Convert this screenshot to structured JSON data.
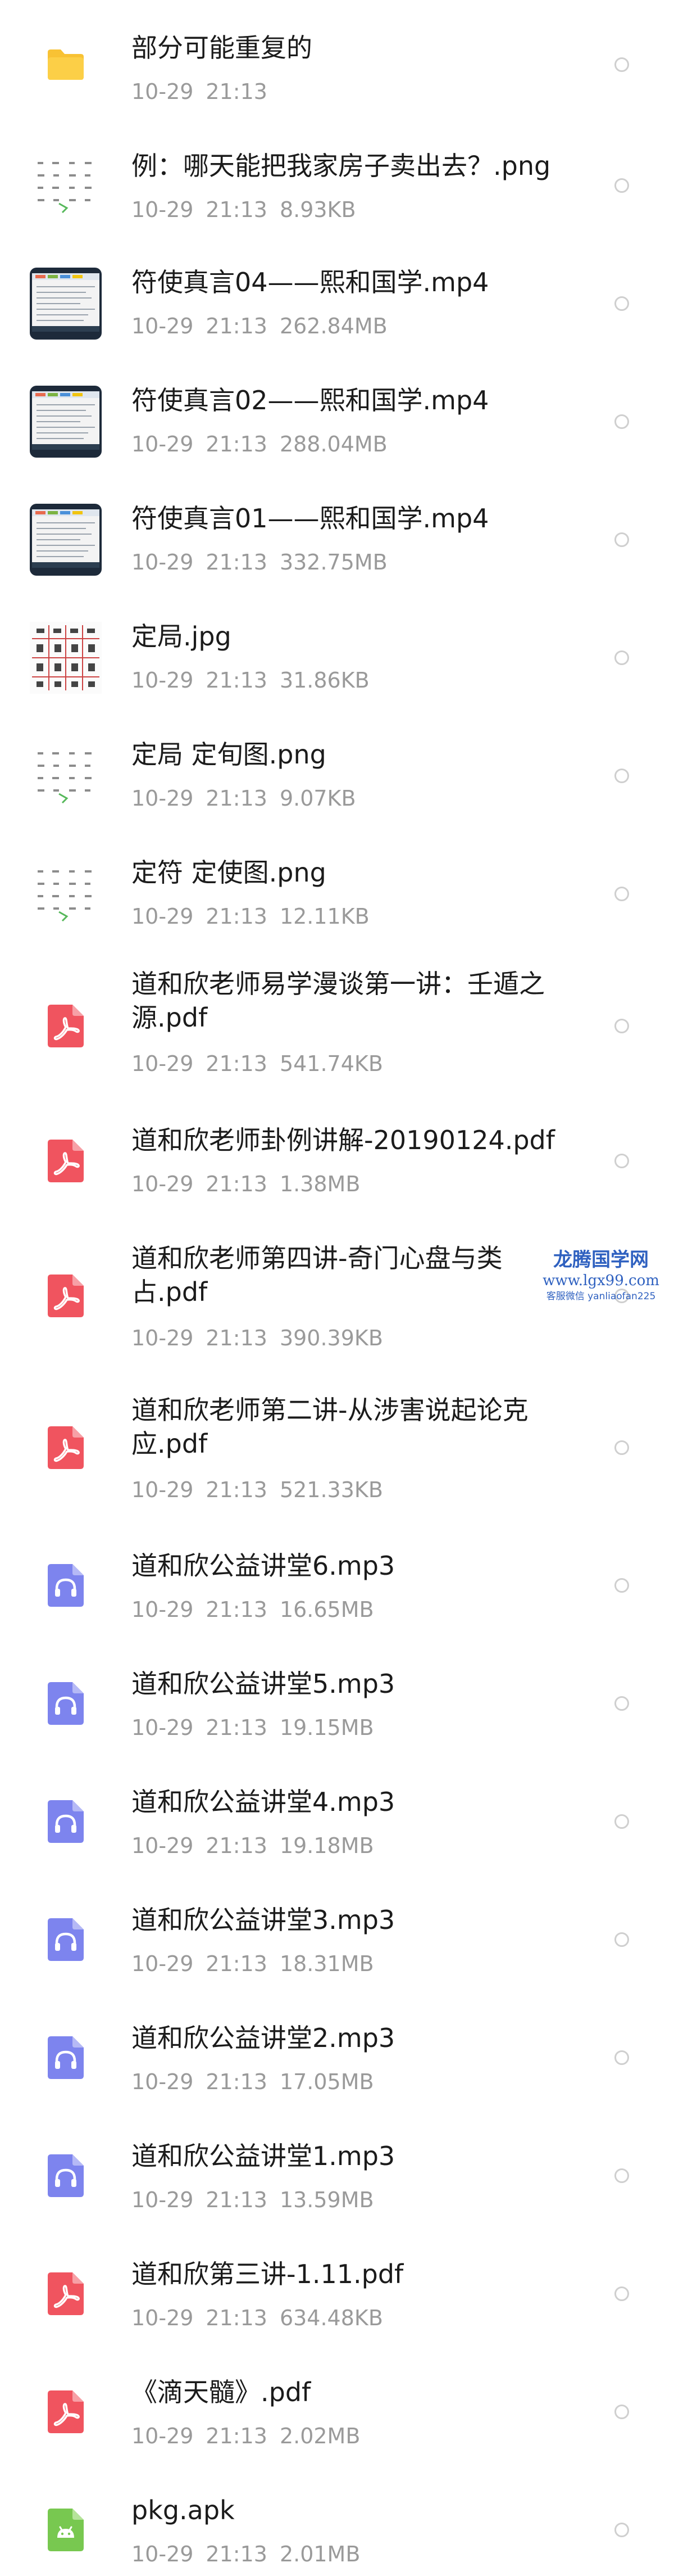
{
  "files": [
    {
      "name": "部分可能重复的",
      "date": "10-29",
      "time": "21:13",
      "size": "",
      "type": "folder"
    },
    {
      "name": "例：哪天能把我家房子卖出去？.png",
      "date": "10-29",
      "time": "21:13",
      "size": "8.93KB",
      "type": "image"
    },
    {
      "name": "符使真言04——熙和国学.mp4",
      "date": "10-29",
      "time": "21:13",
      "size": "262.84MB",
      "type": "video"
    },
    {
      "name": "符使真言02——熙和国学.mp4",
      "date": "10-29",
      "time": "21:13",
      "size": "288.04MB",
      "type": "video"
    },
    {
      "name": "符使真言01——熙和国学.mp4",
      "date": "10-29",
      "time": "21:13",
      "size": "332.75MB",
      "type": "video"
    },
    {
      "name": "定局.jpg",
      "date": "10-29",
      "time": "21:13",
      "size": "31.86KB",
      "type": "image-table"
    },
    {
      "name": "定局 定旬图.png",
      "date": "10-29",
      "time": "21:13",
      "size": "9.07KB",
      "type": "image"
    },
    {
      "name": "定符 定使图.png",
      "date": "10-29",
      "time": "21:13",
      "size": "12.11KB",
      "type": "image"
    },
    {
      "name": "道和欣老师易学漫谈第一讲：壬遁之\n源.pdf",
      "date": "10-29",
      "time": "21:13",
      "size": "541.74KB",
      "type": "pdf"
    },
    {
      "name": "道和欣老师卦例讲解-20190124.pdf",
      "date": "10-29",
      "time": "21:13",
      "size": "1.38MB",
      "type": "pdf"
    },
    {
      "name": "道和欣老师第四讲-奇门心盘与类\n占.pdf",
      "date": "10-29",
      "time": "21:13",
      "size": "390.39KB",
      "type": "pdf"
    },
    {
      "name": "道和欣老师第二讲-从涉害说起论克\n应.pdf",
      "date": "10-29",
      "time": "21:13",
      "size": "521.33KB",
      "type": "pdf"
    },
    {
      "name": "道和欣公益讲堂6.mp3",
      "date": "10-29",
      "time": "21:13",
      "size": "16.65MB",
      "type": "audio"
    },
    {
      "name": "道和欣公益讲堂5.mp3",
      "date": "10-29",
      "time": "21:13",
      "size": "19.15MB",
      "type": "audio"
    },
    {
      "name": "道和欣公益讲堂4.mp3",
      "date": "10-29",
      "time": "21:13",
      "size": "19.18MB",
      "type": "audio"
    },
    {
      "name": "道和欣公益讲堂3.mp3",
      "date": "10-29",
      "time": "21:13",
      "size": "18.31MB",
      "type": "audio"
    },
    {
      "name": "道和欣公益讲堂2.mp3",
      "date": "10-29",
      "time": "21:13",
      "size": "17.05MB",
      "type": "audio"
    },
    {
      "name": "道和欣公益讲堂1.mp3",
      "date": "10-29",
      "time": "21:13",
      "size": "13.59MB",
      "type": "audio"
    },
    {
      "name": "道和欣第三讲-1.11.pdf",
      "date": "10-29",
      "time": "21:13",
      "size": "634.48KB",
      "type": "pdf"
    },
    {
      "name": "《滴天髓》.pdf",
      "date": "10-29",
      "time": "21:13",
      "size": "2.02MB",
      "type": "pdf"
    },
    {
      "name": "pkg.apk",
      "date": "10-29",
      "time": "21:13",
      "size": "2.01MB",
      "type": "apk"
    }
  ],
  "watermark": {
    "title": "龙腾国学网",
    "url": "www.lgx99.com",
    "contact": "客服微信 yanliaofan225"
  },
  "colors": {
    "folder": "#f8c234",
    "pdf": "#f0545f",
    "audio": "#7d84ee",
    "apk": "#78c850",
    "name": "#1b1b1b",
    "meta": "#9a9a9a",
    "watermark": "#2f61c0"
  }
}
